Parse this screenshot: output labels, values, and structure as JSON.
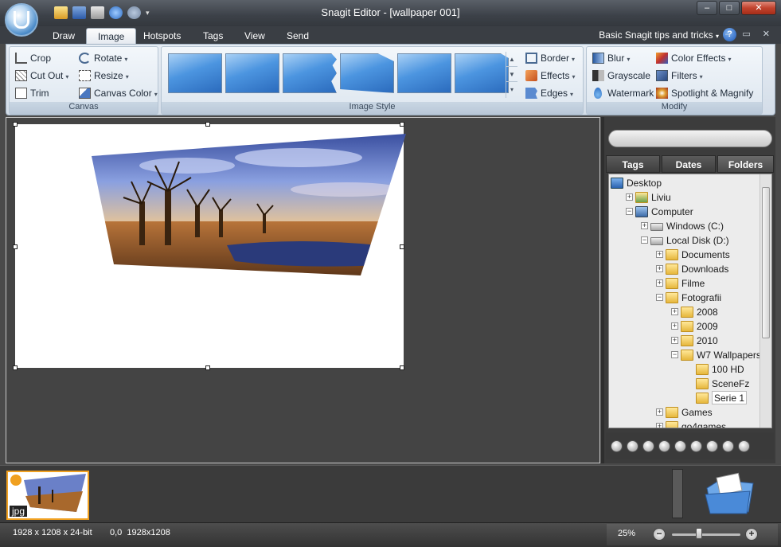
{
  "window": {
    "title": "Snagit Editor - [wallpaper 001]"
  },
  "tabs": [
    "Draw",
    "Image",
    "Hotspots",
    "Tags",
    "View",
    "Send"
  ],
  "active_tab": "Image",
  "help": {
    "label": "Basic Snagit tips and tricks"
  },
  "canvas_group": {
    "label": "Canvas",
    "crop": "Crop",
    "cut_out": "Cut Out",
    "trim": "Trim",
    "rotate": "Rotate",
    "resize": "Resize",
    "canvas_color": "Canvas Color"
  },
  "style_group": {
    "label": "Image Style",
    "border": "Border",
    "effects": "Effects",
    "edges": "Edges"
  },
  "modify_group": {
    "label": "Modify",
    "blur": "Blur",
    "grayscale": "Grayscale",
    "watermark": "Watermark",
    "color_effects": "Color Effects",
    "filters": "Filters",
    "spotlight": "Spotlight & Magnify"
  },
  "library": {
    "tabs": [
      "Tags",
      "Dates",
      "Folders"
    ],
    "active_tab": "Folders",
    "tree": [
      {
        "label": "Desktop",
        "level": 0,
        "kind": "desktop"
      },
      {
        "label": "Liviu",
        "level": 1,
        "kind": "user",
        "expander": "+"
      },
      {
        "label": "Computer",
        "level": 1,
        "kind": "computer",
        "expander": "-"
      },
      {
        "label": "Windows (C:)",
        "level": 2,
        "kind": "drive",
        "expander": "+"
      },
      {
        "label": "Local Disk (D:)",
        "level": 2,
        "kind": "drive",
        "expander": "-"
      },
      {
        "label": "Documents",
        "level": 3,
        "kind": "folder",
        "expander": "+"
      },
      {
        "label": "Downloads",
        "level": 3,
        "kind": "folder",
        "expander": "+"
      },
      {
        "label": "Filme",
        "level": 3,
        "kind": "folder",
        "expander": "+"
      },
      {
        "label": "Fotografii",
        "level": 3,
        "kind": "folder",
        "expander": "-"
      },
      {
        "label": "2008",
        "level": 4,
        "kind": "folder",
        "expander": "+"
      },
      {
        "label": "2009",
        "level": 4,
        "kind": "folder",
        "expander": "+"
      },
      {
        "label": "2010",
        "level": 4,
        "kind": "folder",
        "expander": "+"
      },
      {
        "label": "W7 Wallpapers",
        "level": 4,
        "kind": "folder",
        "expander": "-"
      },
      {
        "label": "100 HD",
        "level": 5,
        "kind": "folder"
      },
      {
        "label": "SceneFz",
        "level": 5,
        "kind": "folder"
      },
      {
        "label": "Serie 1",
        "level": 5,
        "kind": "folder",
        "selected": true
      },
      {
        "label": "Games",
        "level": 3,
        "kind": "folder",
        "expander": "+"
      },
      {
        "label": "go4games",
        "level": 3,
        "kind": "folder",
        "expander": "+"
      }
    ]
  },
  "tray": {
    "thumb_label": "jpg"
  },
  "status": {
    "dimensions": "1928 x 1208 x 24-bit",
    "position": "0,0  1928x1208",
    "zoom": "25%"
  }
}
